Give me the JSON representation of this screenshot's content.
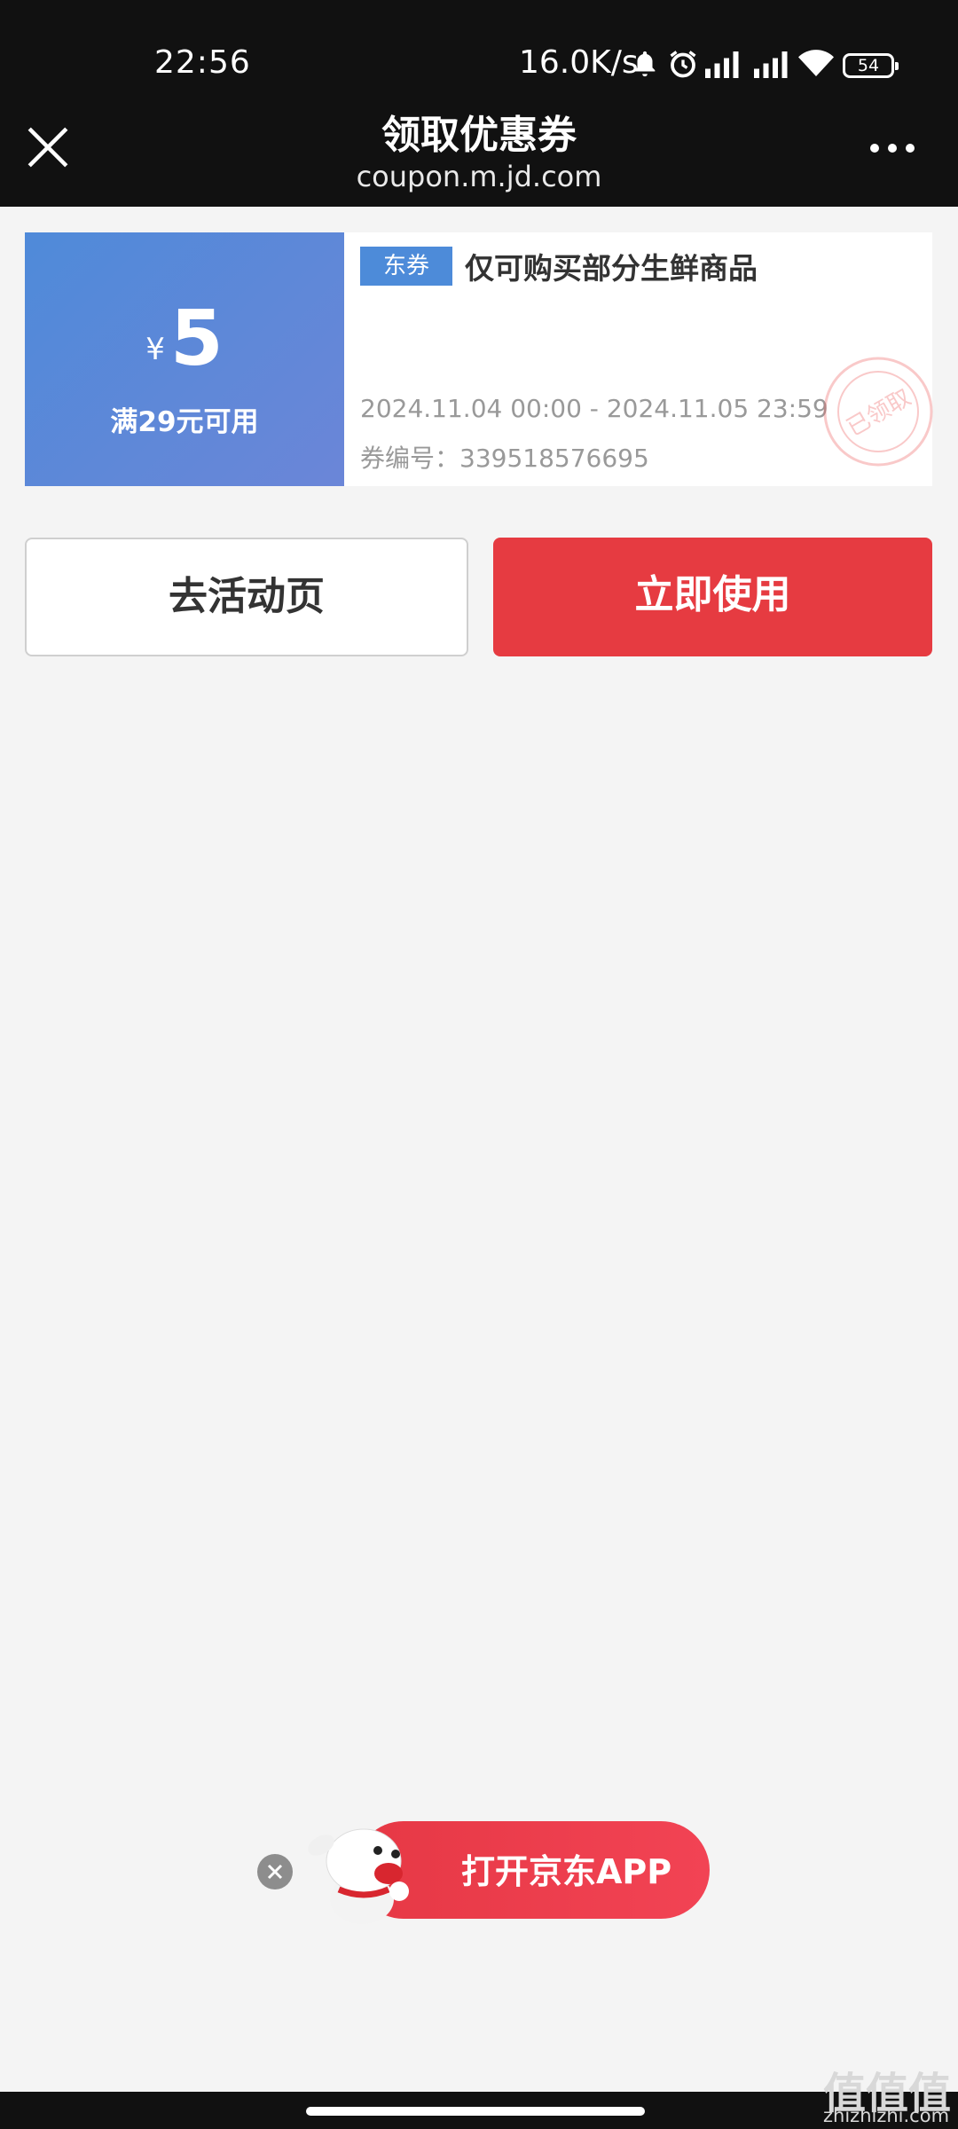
{
  "status": {
    "time": "22:56",
    "net_speed": "16.0K/s",
    "battery": "54"
  },
  "nav": {
    "title": "领取优惠券",
    "url": "coupon.m.jd.com"
  },
  "coupon": {
    "currency": "¥",
    "amount": "5",
    "condition": "满29元可用",
    "tag": "东券",
    "title": "仅可购买部分生鲜商品",
    "validity": "2024.11.04 00:00 - 2024.11.05 23:59",
    "code_label": "券编号：339518576695",
    "stamp_text": "已领取"
  },
  "buttons": {
    "activity": "去活动页",
    "use": "立即使用"
  },
  "open_app": {
    "label": "打开京东APP"
  },
  "watermark": {
    "main": "值值值",
    "sub": "zhizhizhi.com"
  },
  "colors": {
    "accent_red": "#e63b41",
    "coupon_blue": "#4f8ad9",
    "topbar": "#111111"
  }
}
